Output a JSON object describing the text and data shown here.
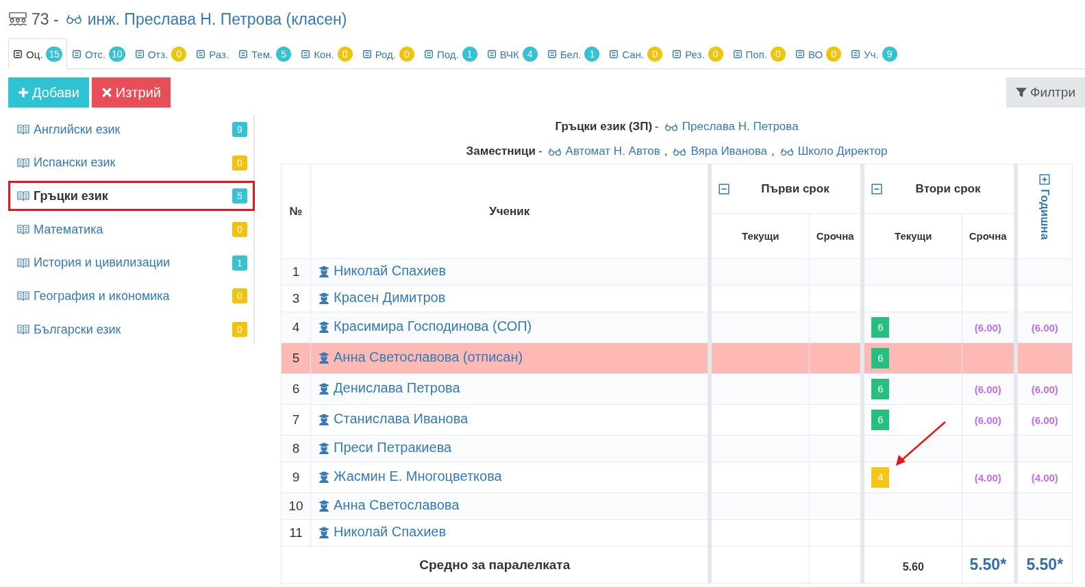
{
  "header": {
    "class_number": "73 -",
    "teacher": "инж. Преслава Н. Петрова (класен)"
  },
  "tabs": [
    {
      "label": "Оц.",
      "count": "15",
      "color": "#35c2d1",
      "selected": true
    },
    {
      "label": "Отс.",
      "count": "10",
      "color": "#35c2d1",
      "selected": false
    },
    {
      "label": "Отз.",
      "count": "0",
      "color": "#f0c30f",
      "selected": false
    },
    {
      "label": "Раз.",
      "selected": false
    },
    {
      "label": "Тем.",
      "count": "5",
      "color": "#35c2d1",
      "selected": false
    },
    {
      "label": "Кон.",
      "count": "0",
      "color": "#f0c30f",
      "selected": false
    },
    {
      "label": "Род.",
      "count": "0",
      "color": "#f0c30f",
      "selected": false
    },
    {
      "label": "Под.",
      "count": "1",
      "color": "#35c2d1",
      "selected": false
    },
    {
      "label": "ВЧК",
      "count": "4",
      "color": "#35c2d1",
      "selected": false
    },
    {
      "label": "Бел.",
      "count": "1",
      "color": "#35c2d1",
      "selected": false
    },
    {
      "label": "Сан.",
      "count": "0",
      "color": "#f0c30f",
      "selected": false
    },
    {
      "label": "Рез.",
      "count": "0",
      "color": "#f0c30f",
      "selected": false
    },
    {
      "label": "Поп.",
      "count": "0",
      "color": "#f0c30f",
      "selected": false
    },
    {
      "label": "ВО",
      "count": "0",
      "color": "#f0c30f",
      "selected": false
    },
    {
      "label": "Уч.",
      "count": "9",
      "color": "#35c2d1",
      "selected": false
    }
  ],
  "actions": {
    "add": "Добави",
    "delete": "Изтрий",
    "filter": "Филтри"
  },
  "subjects": [
    {
      "name": "Английски език",
      "count": "9",
      "color": "#35c2d1",
      "selected": false
    },
    {
      "name": "Испански език",
      "count": "0",
      "color": "#f0c30f",
      "selected": false
    },
    {
      "name": "Гръцки език",
      "count": "5",
      "color": "#35c2d1",
      "selected": true
    },
    {
      "name": "Математика",
      "count": "0",
      "color": "#f0c30f",
      "selected": false
    },
    {
      "name": "История и цивилизации",
      "count": "1",
      "color": "#35c2d1",
      "selected": false
    },
    {
      "name": "География и икономика",
      "count": "0",
      "color": "#f0c30f",
      "selected": false
    },
    {
      "name": "Български език",
      "count": "0",
      "color": "#f0c30f",
      "selected": false
    }
  ],
  "subject_info": {
    "subject": "Гръцки език (ЗП)",
    "subject_dash": "-",
    "teacher": "Преслава Н. Петрова",
    "deputies_label": "Заместници",
    "deputies_dash": "-",
    "deputies": [
      {
        "name": "Автомат Н. Автов"
      },
      {
        "comma": ",",
        "name": "Вяра Иванова"
      },
      {
        "comma": ",",
        "name": "Школо Директор"
      }
    ]
  },
  "table": {
    "col_number": "№",
    "col_student": "Ученик",
    "term1": {
      "title": "Първи срок",
      "expanded": true,
      "sub_current": "Текущи",
      "sub_final": "Срочна"
    },
    "term2": {
      "title": "Втори срок",
      "expanded": true,
      "sub_current": "Текущи",
      "sub_final": "Срочна"
    },
    "annual": {
      "title": "Годишна",
      "expanded": false
    },
    "rows": [
      {
        "number": "1",
        "name": "Николай Спахиев",
        "withdrawn": false,
        "grades": [],
        "term2_final": "",
        "annual": ""
      },
      {
        "number": "3",
        "name": "Красен Димитров",
        "withdrawn": false,
        "grades": [],
        "term2_final": "",
        "annual": ""
      },
      {
        "number": "4",
        "name": "Красимира Господинова (СОП)",
        "withdrawn": false,
        "grades": [
          {
            "value": "6",
            "color": "#26bf7f"
          }
        ],
        "term2_final": "(6.00)",
        "annual": "(6.00)"
      },
      {
        "number": "5",
        "name": "Анна Светославова (отписан)",
        "withdrawn": true,
        "grades": [
          {
            "value": "6",
            "color": "#26bf7f"
          }
        ],
        "term2_final": "",
        "annual": ""
      },
      {
        "number": "6",
        "name": "Денислава Петрова",
        "withdrawn": false,
        "grades": [
          {
            "value": "6",
            "color": "#26bf7f"
          }
        ],
        "term2_final": "(6.00)",
        "annual": "(6.00)"
      },
      {
        "number": "7",
        "name": "Станислава Иванова",
        "withdrawn": false,
        "grades": [
          {
            "value": "6",
            "color": "#26bf7f"
          }
        ],
        "term2_final": "(6.00)",
        "annual": "(6.00)"
      },
      {
        "number": "8",
        "name": "Преси Петракиева",
        "withdrawn": false,
        "grades": [],
        "term2_final": "",
        "annual": ""
      },
      {
        "number": "9",
        "name": "Жасмин Е. Многоцветкова",
        "withdrawn": false,
        "grades": [
          {
            "value": "4",
            "color": "#f5c518"
          }
        ],
        "term2_final": "(4.00)",
        "annual": "(4.00)"
      },
      {
        "number": "10",
        "name": "Анна Светославова",
        "withdrawn": false,
        "grades": [],
        "term2_final": "",
        "annual": ""
      },
      {
        "number": "11",
        "name": "Николай Спахиев",
        "withdrawn": false,
        "grades": [],
        "term2_final": "",
        "annual": ""
      }
    ],
    "footer": {
      "label": "Средно за паралелката",
      "term2_current": "5.60",
      "term2_final": "5.50*",
      "annual": "5.50*"
    }
  }
}
